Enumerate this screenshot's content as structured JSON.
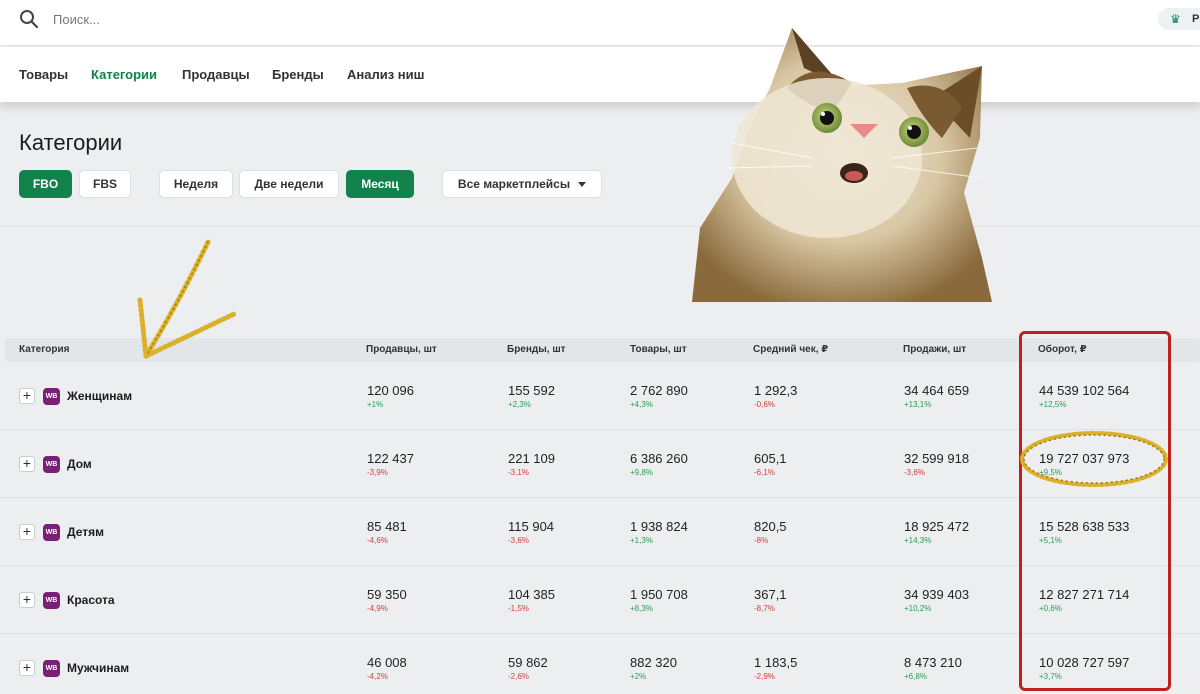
{
  "search": {
    "placeholder": "Поиск..."
  },
  "premium": {
    "label": "P"
  },
  "nav": {
    "items": [
      {
        "label": "Товары"
      },
      {
        "label": "Категории"
      },
      {
        "label": "Продавцы"
      },
      {
        "label": "Бренды"
      },
      {
        "label": "Анализ ниш"
      }
    ],
    "active": "Категории"
  },
  "page": {
    "title": "Категории"
  },
  "filters": {
    "fbo": "FBO",
    "fbs": "FBS",
    "week": "Неделя",
    "two_weeks": "Две недели",
    "month": "Месяц",
    "marketplaces": "Все маркетплейсы"
  },
  "table": {
    "headers": {
      "category": "Категория",
      "sellers": "Продавцы, шт",
      "brands": "Бренды, шт",
      "goods": "Товары, шт",
      "avg_check": "Средний чек, ₽",
      "sales": "Продажи, шт",
      "turnover": "Оборот, ₽"
    },
    "logo_text": "WB",
    "rows": [
      {
        "name": "Женщинам",
        "sellers": {
          "v": "120 096",
          "c": "+1%"
        },
        "brands": {
          "v": "155 592",
          "c": "+2,3%"
        },
        "goods": {
          "v": "2 762 890",
          "c": "+4,3%"
        },
        "avg_check": {
          "v": "1 292,3",
          "c": "-0,6%"
        },
        "sales": {
          "v": "34 464 659",
          "c": "+13,1%"
        },
        "turnover": {
          "v": "44 539 102 564",
          "c": "+12,5%"
        }
      },
      {
        "name": "Дом",
        "sellers": {
          "v": "122 437",
          "c": "-3,9%"
        },
        "brands": {
          "v": "221 109",
          "c": "-3,1%"
        },
        "goods": {
          "v": "6 386 260",
          "c": "+9,8%"
        },
        "avg_check": {
          "v": "605,1",
          "c": "-6,1%"
        },
        "sales": {
          "v": "32 599 918",
          "c": "-3,6%"
        },
        "turnover": {
          "v": "19 727 037 973",
          "c": "+9,5%"
        }
      },
      {
        "name": "Детям",
        "sellers": {
          "v": "85 481",
          "c": "-4,6%"
        },
        "brands": {
          "v": "115 904",
          "c": "-3,6%"
        },
        "goods": {
          "v": "1 938 824",
          "c": "+1,3%"
        },
        "avg_check": {
          "v": "820,5",
          "c": "-8%"
        },
        "sales": {
          "v": "18 925 472",
          "c": "+14,3%"
        },
        "turnover": {
          "v": "15 528 638 533",
          "c": "+5,1%"
        }
      },
      {
        "name": "Красота",
        "sellers": {
          "v": "59 350",
          "c": "-4,9%"
        },
        "brands": {
          "v": "104 385",
          "c": "-1,5%"
        },
        "goods": {
          "v": "1 950 708",
          "c": "+8,3%"
        },
        "avg_check": {
          "v": "367,1",
          "c": "-8,7%"
        },
        "sales": {
          "v": "34 939 403",
          "c": "+10,2%"
        },
        "turnover": {
          "v": "12 827 271 714",
          "c": "+0,6%"
        }
      },
      {
        "name": "Мужчинам",
        "sellers": {
          "v": "46 008",
          "c": "-4,2%"
        },
        "brands": {
          "v": "59 862",
          "c": "-2,6%"
        },
        "goods": {
          "v": "882 320",
          "c": "+2%"
        },
        "avg_check": {
          "v": "1 183,5",
          "c": "-2,9%"
        },
        "sales": {
          "v": "8 473 210",
          "c": "+6,8%"
        },
        "turnover": {
          "v": "10 028 727 597",
          "c": "+3,7%"
        }
      }
    ]
  },
  "colors": {
    "accent": "#12824c",
    "positive": "#2a9d55",
    "negative": "#d0413e",
    "highlight_box": "#c0201a",
    "glitter": "#d9b12a",
    "wb_brand": "#7b1e7a"
  },
  "icons": [
    "search-icon",
    "crown-icon",
    "caret-down-icon",
    "plus-icon",
    "wb-logo-icon"
  ]
}
